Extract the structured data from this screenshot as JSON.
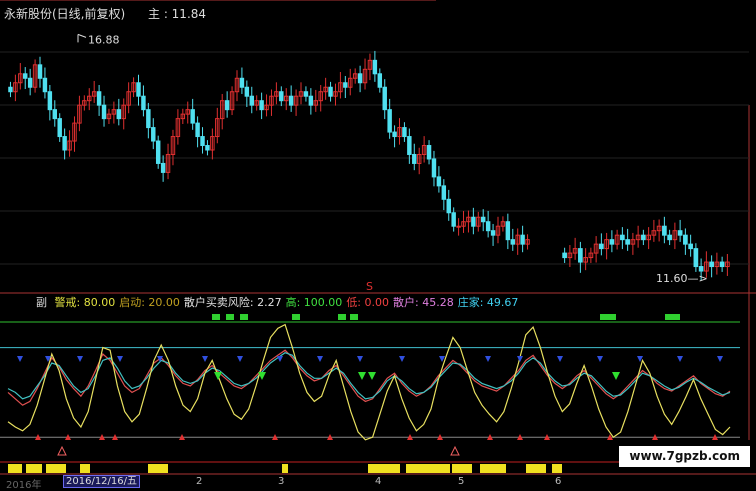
{
  "header": {
    "title": "永新股份(日线,前复权)",
    "price_label": "主 : 11.84"
  },
  "annotations": {
    "high": "16.88",
    "low": "11.60",
    "signal": "S"
  },
  "indicator": {
    "name": "副",
    "items": [
      {
        "label": "警戒:",
        "value": "80.00",
        "color": "#e0e040"
      },
      {
        "label": "启动:",
        "value": "20.00",
        "color": "#c0a020"
      },
      {
        "label": "散户买卖风险:",
        "value": "2.27",
        "color": "#e0e0e0"
      },
      {
        "label": "高:",
        "value": "100.00",
        "color": "#40e040"
      },
      {
        "label": "低:",
        "value": "0.00",
        "color": "#f04040"
      },
      {
        "label": "散户:",
        "value": "45.28",
        "color": "#e080e0"
      },
      {
        "label": "庄家:",
        "value": "49.67",
        "color": "#40d0f0"
      }
    ]
  },
  "axis": {
    "corner": "2016年",
    "date_box": "2016/12/16/五",
    "ticks": [
      "2",
      "3",
      "4",
      "5",
      "6"
    ]
  },
  "watermark": "www.7gpzb.com",
  "colors": {
    "up": "#e03030",
    "down": "#50e0f0",
    "warning_line": "#30c030",
    "cyan_line": "#40c0d0",
    "red_line": "#c02020"
  },
  "chart_data": [
    {
      "type": "candlestick",
      "title": "永新股份(日线,前复权)",
      "segments": [
        {
          "note": "segment 1",
          "closes": [
            15.6,
            15.8,
            16.0,
            15.9,
            15.7,
            16.2,
            15.9,
            15.6,
            15.2,
            15.0,
            14.6,
            14.3,
            14.5,
            14.9,
            15.3,
            15.4,
            15.5,
            15.6,
            15.3,
            15.0,
            15.1,
            15.2,
            15.0,
            15.3,
            15.6,
            15.8,
            15.5,
            15.2,
            14.8,
            14.5,
            14.0,
            13.8,
            14.2,
            14.6,
            15.0,
            15.1,
            15.2,
            14.9,
            14.6,
            14.4,
            14.3,
            14.6,
            15.0,
            15.4,
            15.2,
            15.6,
            15.9,
            15.7,
            15.5,
            15.3,
            15.4,
            15.2,
            15.3,
            15.5,
            15.6,
            15.4,
            15.5,
            15.3,
            15.5,
            15.6,
            15.5,
            15.3,
            15.4,
            15.6,
            15.7,
            15.5,
            15.6,
            15.8,
            15.7,
            15.9,
            16.0,
            15.8,
            16.1,
            16.3,
            16.0,
            15.7,
            15.2,
            14.7,
            14.6,
            14.8,
            14.6,
            14.2,
            14.0,
            14.2,
            14.4,
            14.1,
            13.7,
            13.5,
            13.2,
            12.9,
            12.6,
            12.6,
            12.7,
            12.8,
            12.6,
            12.8,
            12.7,
            12.5,
            12.4,
            12.6,
            12.7,
            12.3,
            12.2,
            12.4,
            12.2,
            12.3
          ]
        },
        {
          "note": "segment 2",
          "closes": [
            11.9,
            12.0,
            12.1,
            11.8,
            11.9,
            12.0,
            12.2,
            12.1,
            12.3,
            12.2,
            12.4,
            12.3,
            12.2,
            12.3,
            12.4,
            12.3,
            12.4,
            12.5,
            12.6,
            12.4,
            12.3,
            12.5,
            12.4,
            12.2,
            12.1,
            11.7,
            11.6,
            11.8,
            11.7,
            11.8,
            11.7,
            11.8
          ]
        }
      ],
      "high_marker": 16.88,
      "low_marker": 11.6,
      "last": 11.84
    },
    {
      "type": "line",
      "title": "副",
      "ylim": [
        0,
        100
      ],
      "levels": {
        "warning": 80.0,
        "start": 20.0,
        "high": 100.0,
        "low": 0.0
      },
      "series": [
        {
          "name": "散户",
          "color": "#e05050",
          "values": [
            45,
            40,
            35,
            38,
            48,
            60,
            72,
            65,
            55,
            48,
            42,
            50,
            62,
            75,
            70,
            60,
            50,
            45,
            48,
            58,
            68,
            72,
            66,
            58,
            52,
            50,
            55,
            62,
            66,
            60,
            55,
            50,
            48,
            52,
            58,
            64,
            70,
            74,
            78,
            72,
            64,
            58,
            54,
            56,
            62,
            66,
            58,
            50,
            42,
            38,
            40,
            48,
            56,
            60,
            52,
            46,
            42,
            45,
            50,
            58,
            64,
            70,
            66,
            60,
            54,
            50,
            48,
            46,
            50,
            56,
            62,
            70,
            74,
            66,
            58,
            52,
            48,
            52,
            58,
            62,
            56,
            50,
            44,
            40,
            44,
            50,
            56,
            62,
            58,
            52,
            48,
            46,
            50,
            54,
            58,
            52,
            48,
            44,
            42,
            46
          ]
        },
        {
          "name": "庄家",
          "color": "#40c0c0",
          "values": [
            48,
            45,
            40,
            42,
            50,
            58,
            68,
            66,
            58,
            50,
            45,
            48,
            58,
            70,
            72,
            64,
            54,
            48,
            50,
            56,
            64,
            70,
            68,
            60,
            54,
            52,
            54,
            60,
            64,
            62,
            57,
            52,
            50,
            52,
            56,
            62,
            68,
            72,
            76,
            74,
            66,
            60,
            56,
            56,
            60,
            64,
            60,
            52,
            45,
            40,
            41,
            46,
            54,
            58,
            54,
            48,
            44,
            45,
            49,
            56,
            62,
            68,
            67,
            62,
            56,
            52,
            50,
            48,
            50,
            54,
            60,
            68,
            72,
            68,
            60,
            54,
            50,
            51,
            56,
            60,
            58,
            52,
            46,
            42,
            43,
            48,
            54,
            60,
            58,
            54,
            50,
            47,
            49,
            53,
            56,
            53,
            49,
            46,
            43,
            45
          ]
        },
        {
          "name": "散户买卖风险",
          "color": "#e8e060",
          "values": [
            22,
            18,
            15,
            20,
            35,
            55,
            75,
            62,
            40,
            25,
            18,
            30,
            55,
            80,
            78,
            50,
            30,
            22,
            28,
            48,
            70,
            82,
            70,
            50,
            35,
            30,
            40,
            60,
            70,
            55,
            40,
            28,
            24,
            32,
            50,
            70,
            88,
            95,
            98,
            80,
            60,
            45,
            38,
            42,
            58,
            70,
            50,
            30,
            14,
            8,
            10,
            28,
            46,
            58,
            40,
            25,
            15,
            20,
            32,
            55,
            72,
            88,
            80,
            62,
            45,
            35,
            28,
            22,
            30,
            48,
            68,
            90,
            96,
            80,
            60,
            42,
            30,
            36,
            52,
            66,
            50,
            32,
            18,
            10,
            14,
            30,
            50,
            70,
            60,
            42,
            28,
            20,
            30,
            42,
            55,
            40,
            28,
            16,
            12,
            18
          ]
        }
      ]
    }
  ]
}
